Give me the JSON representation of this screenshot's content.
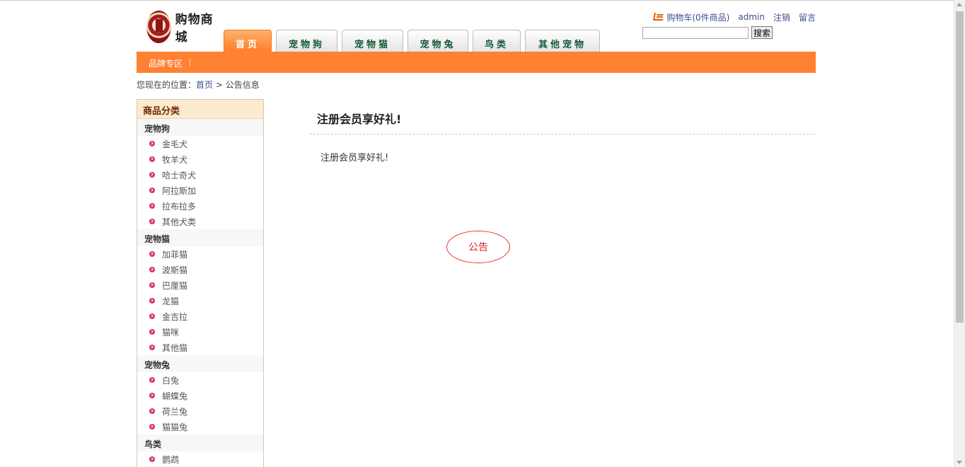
{
  "header": {
    "logo_text": "购物商城",
    "nav": [
      {
        "label": "首页",
        "active": true
      },
      {
        "label": "宠物狗"
      },
      {
        "label": "宠物猫"
      },
      {
        "label": "宠物兔"
      },
      {
        "label": "鸟类"
      },
      {
        "label": "其他宠物"
      }
    ],
    "top_links": {
      "cart": "购物车(0件商品)",
      "user": "admin",
      "logout": "注销",
      "message": "留言"
    },
    "search": {
      "value": "",
      "placeholder": "",
      "button": "搜索"
    },
    "brand_link": "品牌专区"
  },
  "breadcrumb": {
    "prefix": "您现在的位置：",
    "home": "首页",
    "sep": ">",
    "current": "公告信息"
  },
  "sidebar": {
    "title": "商品分类",
    "categories": [
      {
        "name": "宠物狗",
        "items": [
          "金毛犬",
          "牧羊犬",
          "哈士奇犬",
          "阿拉斯加",
          "拉布拉多",
          "其他犬类"
        ]
      },
      {
        "name": "宠物猫",
        "items": [
          "加菲猫",
          "波斯猫",
          "巴厘猫",
          "龙猫",
          "金吉拉",
          "猫咪",
          "其他猫"
        ]
      },
      {
        "name": "宠物兔",
        "items": [
          "白兔",
          "蝴蝶兔",
          "荷兰兔",
          "猫猫兔"
        ]
      },
      {
        "name": "鸟类",
        "items": [
          "鹦鹉"
        ]
      }
    ]
  },
  "notice": {
    "title": "注册会员享好礼!",
    "content": "注册会员享好礼!"
  },
  "stamp": {
    "label": "公告"
  },
  "colors": {
    "accent": "#ff8132",
    "nav_text": "#135a37",
    "link": "#3c4f8a",
    "stamp": "#e33333"
  }
}
